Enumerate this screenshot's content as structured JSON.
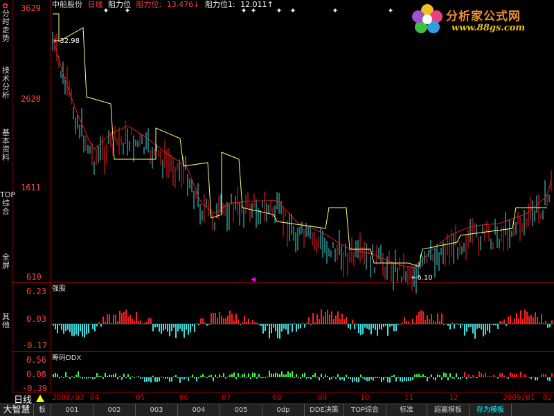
{
  "header": {
    "stock_name": "中船股份",
    "period": "日线",
    "indicator": "阻力位",
    "resist1_label": "阻力位:",
    "resist1_value": "13.476↓",
    "resist2_label": "阻力位1:",
    "resist2_value": "12.011↑"
  },
  "left_tabs": [
    "分时走势",
    "技术分析",
    "基本资料",
    "TOP综合",
    "全屏",
    "其他"
  ],
  "gear_icon": "✿",
  "main_axis": {
    "labels": [
      "3629",
      "2620",
      "1611",
      "610"
    ],
    "annotations": {
      "high": "←32.98",
      "low": "←6.10"
    }
  },
  "panel2": {
    "title": "强股",
    "labels": [
      "0.23",
      "0.03",
      "-0.17"
    ]
  },
  "panel3": {
    "title": "筹码DDX",
    "labels": [
      "0.56",
      "0.08",
      "-0.39"
    ]
  },
  "period_row": {
    "label": "日线",
    "months": [
      "2008/03",
      "04",
      "05",
      "06",
      "07",
      "08",
      "09",
      "10",
      "11",
      "12",
      "2009/01",
      "02"
    ]
  },
  "bottom_tabs": [
    "大智慧",
    "板",
    "001",
    "002",
    "003",
    "004",
    "005",
    "0dp",
    "DDE决策",
    "TOP综合",
    "标准",
    "超赢模板",
    "存为模板"
  ],
  "logo": {
    "cn": "分析家公式网",
    "url": "www.88gs.com"
  },
  "colors": {
    "up": "#ff2020",
    "down": "#40e0e0",
    "accent": "#ff2020",
    "yellow": "#ffff80",
    "ma": "#e02020"
  }
}
